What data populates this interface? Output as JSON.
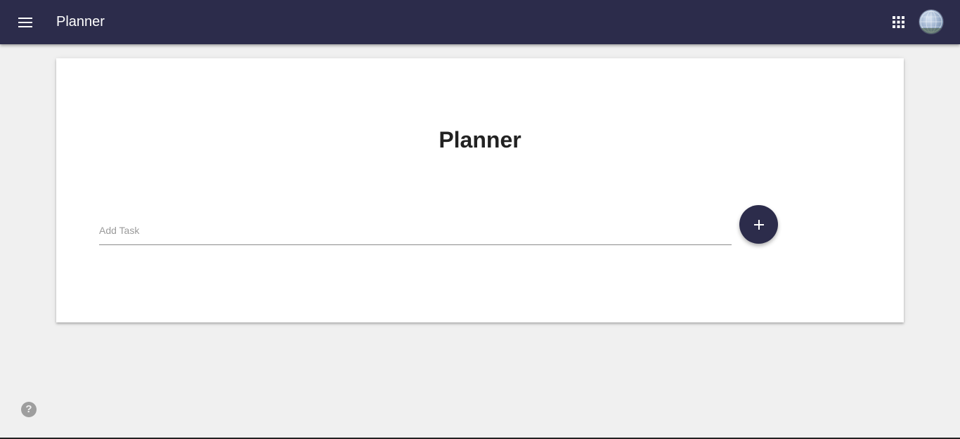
{
  "header": {
    "title": "Planner",
    "menu_icon": "menu-icon",
    "apps_icon": "apps-grid-icon",
    "avatar": "user-avatar",
    "background": "#2c2c4b"
  },
  "card": {
    "title": "Planner",
    "task_input": {
      "placeholder": "Add Task",
      "value": ""
    },
    "add_button": {
      "icon": "plus-icon",
      "label": "+"
    }
  },
  "help": {
    "icon": "help-icon",
    "label": "?"
  },
  "colors": {
    "accent": "#2c2c4b",
    "page_background": "#f0f0f0"
  }
}
